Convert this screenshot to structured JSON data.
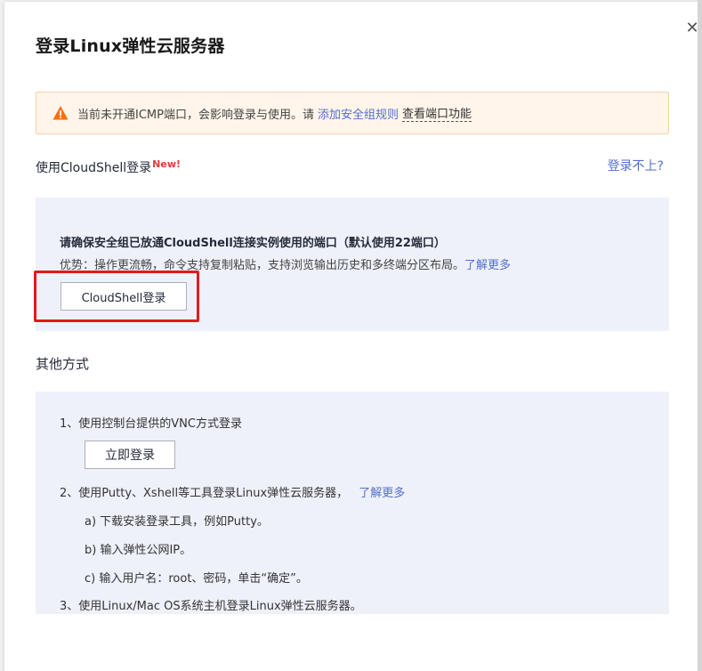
{
  "modal": {
    "title": "登录Linux弹性云服务器",
    "close_icon": "close-icon"
  },
  "warning": {
    "text": "当前未开通ICMP端口，会影响登录与使用。请",
    "link_add_rule": "添加安全组规则",
    "link_view_ports": "查看端口功能",
    "icon": "warning-triangle-icon",
    "color": "#f66f0e"
  },
  "cloudshell": {
    "title": "使用CloudShell登录",
    "new_badge": "New!",
    "cant_login": "登录不上?",
    "notice": "请确保安全组已放通CloudShell连接实例使用的端口（默认使用22端口）",
    "advantage": "优势：操作更流畅，命令支持复制粘贴，支持浏览输出历史和多终端分区布局。",
    "learn_more": "了解更多",
    "button": "CloudShell登录"
  },
  "other": {
    "title": "其他方式",
    "step1": "1、使用控制台提供的VNC方式登录",
    "login_now": "立即登录",
    "step2": "2、使用Putty、Xshell等工具登录Linux弹性云服务器，",
    "step2_link": "了解更多",
    "step2a": "a) 下载安装登录工具，例如Putty。",
    "step2b": "b) 输入弹性公网IP。",
    "step2c": "c) 输入用户名：root、密码，单击“确定”。",
    "step3": "3、使用Linux/Mac OS系统主机登录Linux弹性云服务器。"
  },
  "colors": {
    "link": "#526ecc",
    "highlight": "#e11b1b",
    "panel_bg": "#eef1fa",
    "warning_bg": "#fff5ea"
  }
}
